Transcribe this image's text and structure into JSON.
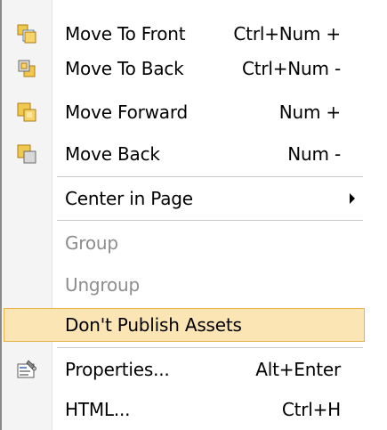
{
  "menu": {
    "arrange": [
      {
        "label": "Move To Front",
        "shortcut": "Ctrl+Num +",
        "icon": "bring-to-front-icon"
      },
      {
        "label": "Move To Back",
        "shortcut": "Ctrl+Num -",
        "icon": "send-to-back-icon"
      },
      {
        "label": "Move Forward",
        "shortcut": "Num +",
        "icon": "bring-forward-icon"
      },
      {
        "label": "Move Back",
        "shortcut": "Num -",
        "icon": "send-backward-icon"
      }
    ],
    "center_in_page": {
      "label": "Center in Page",
      "has_submenu": true
    },
    "group": {
      "label": "Group",
      "enabled": false
    },
    "ungroup": {
      "label": "Ungroup",
      "enabled": false
    },
    "dont_publish": {
      "label": "Don't Publish Assets",
      "highlighted": true
    },
    "properties": {
      "label": "Properties...",
      "shortcut": "Alt+Enter",
      "icon": "properties-icon"
    },
    "html": {
      "label": "HTML...",
      "shortcut": "Ctrl+H"
    }
  },
  "colors": {
    "highlight_fill": "#fbe5b5",
    "highlight_border": "#e8b24c",
    "disabled_text": "#8d8d8d",
    "gutter": "#f4f4f4"
  }
}
